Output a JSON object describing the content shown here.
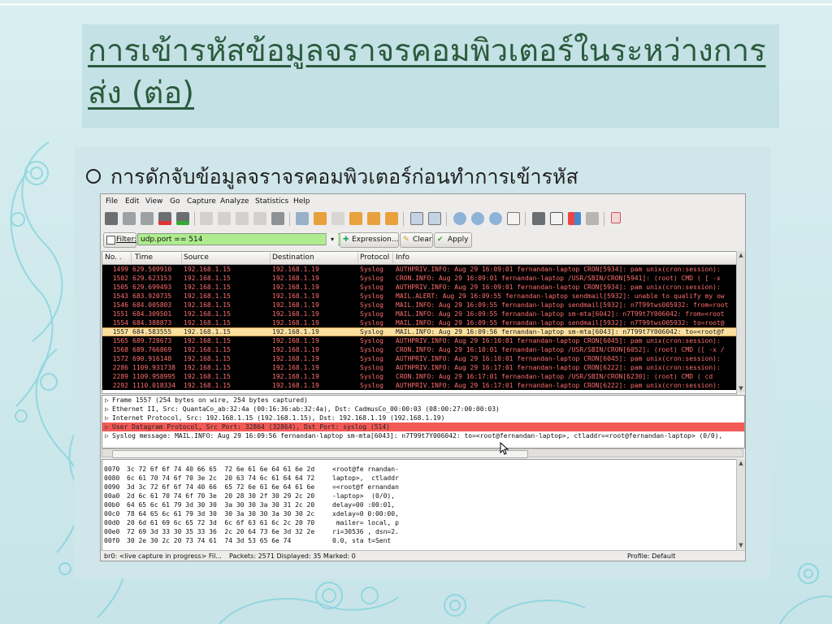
{
  "slide": {
    "title": "การเข้ารหัสข้อมูลจราจรคอมพิวเตอร์ในระหว่างการส่ง (ต่อ)",
    "bullet": "การดักจับข้อมูลจราจรคอมพิวเตอร์ก่อนทำการเข้ารหัส"
  },
  "wireshark": {
    "menu": [
      "File",
      "Edit",
      "View",
      "Go",
      "Capture",
      "Analyze",
      "Statistics",
      "Help"
    ],
    "toolbar_icons": [
      "interface-list-icon",
      "capture-options-icon",
      "start-capture-icon",
      "stop-capture-icon",
      "restart-capture-icon",
      "open-file-icon",
      "save-file-icon",
      "close-file-icon",
      "reload-icon",
      "print-icon",
      "find-packet-icon",
      "go-back-icon",
      "go-forward-icon",
      "go-to-packet-icon",
      "go-first-icon",
      "go-last-icon",
      "colorize-icon",
      "auto-scroll-icon",
      "zoom-in-icon",
      "zoom-out-icon",
      "normal-size-icon",
      "resize-columns-icon",
      "capture-filters-icon",
      "display-filters-icon",
      "coloring-rules-icon",
      "preferences-icon",
      "help-icon"
    ],
    "filter": {
      "label": "Filter:",
      "value": "udp.port == 514",
      "expression_button": "Expression...",
      "clear_button": "Clear",
      "apply_button": "Apply"
    },
    "columns": [
      "No. .",
      "Time",
      "Source",
      "Destination",
      "Protocol",
      "Info"
    ],
    "packets": [
      {
        "no": "1499",
        "time": "629.509910",
        "src": "192.168.1.15",
        "dst": "192.168.1.19",
        "proto": "Syslog",
        "info": "AUTHPRIV.INFO: Aug 29 16:09:01 fernandan-laptop CRON[5934]: pam unix(cron:session):"
      },
      {
        "no": "1502",
        "time": "629.623153",
        "src": "192.168.1.15",
        "dst": "192.168.1.19",
        "proto": "Syslog",
        "info": "CRON.INFO: Aug 29 16:09:01 fernandan-laptop /USR/SBIN/CRON[5941]: (root) CMD (  [ -x"
      },
      {
        "no": "1505",
        "time": "629.699493",
        "src": "192.168.1.15",
        "dst": "192.168.1.19",
        "proto": "Syslog",
        "info": "AUTHPRIV.INFO: Aug 29 16:09:01 fernandan-laptop CRON[5934]: pam unix(cron:session):"
      },
      {
        "no": "1543",
        "time": "683.920735",
        "src": "192.168.1.15",
        "dst": "192.168.1.19",
        "proto": "Syslog",
        "info": "MAIL.ALERT: Aug 29 16:09:55 fernandan-laptop sendmail[5932]: unable to qualify my ow"
      },
      {
        "no": "1546",
        "time": "684.005803",
        "src": "192.168.1.15",
        "dst": "192.168.1.19",
        "proto": "Syslog",
        "info": "MAIL.INFO: Aug 29 16:09:55 fernandan-laptop sendmail[5932]: n7T99tws005932: from=root"
      },
      {
        "no": "1551",
        "time": "684.309501",
        "src": "192.168.1.15",
        "dst": "192.168.1.19",
        "proto": "Syslog",
        "info": "MAIL.INFO: Aug 29 16:09:55 fernandan-laptop sm-mta[6042]: n7T99t7Y006042: from=<root"
      },
      {
        "no": "1554",
        "time": "684.388873",
        "src": "192.168.1.15",
        "dst": "192.168.1.19",
        "proto": "Syslog",
        "info": "MAIL.INFO: Aug 29 16:09:55 fernandan-laptop sendmail[5932]: n7T99tws005932: to=root@"
      },
      {
        "no": "1557",
        "time": "684.583555",
        "src": "192.168.1.15",
        "dst": "192.168.1.19",
        "proto": "Syslog",
        "info": "MAIL.INFO: Aug 29 16:09:56 fernandan-laptop sm-mta[6043]: n7T99t7Y006042: to=<root@f",
        "selected": true
      },
      {
        "no": "1565",
        "time": "689.728673",
        "src": "192.168.1.15",
        "dst": "192.168.1.19",
        "proto": "Syslog",
        "info": "AUTHPRIV.INFO: Aug 29 16:10:01 fernandan-laptop CRON[6045]: pam unix(cron:session):"
      },
      {
        "no": "1568",
        "time": "689.766869",
        "src": "192.168.1.15",
        "dst": "192.168.1.19",
        "proto": "Syslog",
        "info": "CRON.INFO: Aug 29 16:10:01 fernandan-laptop /USR/SBIN/CRON[6052]: (root) CMD ([ -x /"
      },
      {
        "no": "1572",
        "time": "690.916148",
        "src": "192.168.1.15",
        "dst": "192.168.1.19",
        "proto": "Syslog",
        "info": "AUTHPRIV.INFO: Aug 29 16:10:01 fernandan-laptop CRON[6045]: pam unix(cron:session):"
      },
      {
        "no": "2286",
        "time": "1109.931738",
        "src": "192.168.1.15",
        "dst": "192.168.1.19",
        "proto": "Syslog",
        "info": "AUTHPRIV.INFO: Aug 29 16:17:01 fernandan-laptop CRON[6222]: pam unix(cron:session):"
      },
      {
        "no": "2289",
        "time": "1109.958995",
        "src": "192.168.1.15",
        "dst": "192.168.1.19",
        "proto": "Syslog",
        "info": "CRON.INFO: Aug 29 16:17:01 fernandan-laptop /USR/SBIN/CRON[6230]: (root) CMD (   cd"
      },
      {
        "no": "2292",
        "time": "1110.018334",
        "src": "192.168.1.15",
        "dst": "192.168.1.19",
        "proto": "Syslog",
        "info": "AUTHPRIV.INFO: Aug 29 16:17:01 fernandan-laptop CRON[6222]: pam unix(cron:session):"
      }
    ],
    "details": [
      {
        "text": "Frame 1557 (254 bytes on wire, 254 bytes captured)"
      },
      {
        "text": "Ethernet II, Src: QuantaCo_ab:32:4a (00:16:36:ab:32:4a), Dst: CadmusCo_00:00:03 (08:00:27:00:00:03)"
      },
      {
        "text": "Internet Protocol, Src: 192.168.1.15 (192.168.1.15), Dst: 192.168.1.19 (192.168.1.19)"
      },
      {
        "text": "User Datagram Protocol, Src Port: 32864 (32864), Dst Port: syslog (514)",
        "highlight": true
      },
      {
        "text": "Syslog message: MAIL.INFO: Aug 29 16:09:56 fernandan-laptop sm-mta[6043]: n7T99t7Y006042: to=<root@fernandan-laptop>, ctladdr=<root@fernandan-laptop> (0/0),"
      }
    ],
    "hex": [
      {
        "off": "0070",
        "bytes": "3c 72 6f 6f 74 40 66 65  72 6e 61 6e 64 61 6e 2d",
        "ascii": "<root@fe rnandan-"
      },
      {
        "off": "0080",
        "bytes": "6c 61 70 74 6f 70 3e 2c  20 63 74 6c 61 64 64 72",
        "ascii": "laptop>,  ctladdr"
      },
      {
        "off": "0090",
        "bytes": "3d 3c 72 6f 6f 74 40 66  65 72 6e 61 6e 64 61 6e",
        "ascii": "=<root@f ernandan"
      },
      {
        "off": "00a0",
        "bytes": "2d 6c 61 70 74 6f 70 3e  20 28 30 2f 30 29 2c 20",
        "ascii": "-laptop>  (0/0),"
      },
      {
        "off": "00b0",
        "bytes": "64 65 6c 61 79 3d 30 30  3a 30 30 3a 30 31 2c 20",
        "ascii": "delay=00 :00:01,"
      },
      {
        "off": "00c0",
        "bytes": "78 64 65 6c 61 79 3d 30  30 3a 30 30 3a 30 30 2c",
        "ascii": "xdelay=0 0:00:00,"
      },
      {
        "off": "00d0",
        "bytes": "20 6d 61 69 6c 65 72 3d  6c 6f 63 61 6c 2c 20 70",
        "ascii": " mailer= local, p"
      },
      {
        "off": "00e0",
        "bytes": "72 69 3d 33 30 35 33 36  2c 20 64 73 6e 3d 32 2e",
        "ascii": "ri=30536 , dsn=2."
      },
      {
        "off": "00f0",
        "bytes": "30 2e 30 2c 20 73 74 61  74 3d 53 65 6e 74",
        "ascii": "0.0, sta t=Sent"
      }
    ],
    "status": {
      "capture": "br0: <live capture in progress> Fil...",
      "packets": "Packets: 2571 Displayed: 35 Marked: 0",
      "profile": "Profile: Default"
    },
    "colors": {
      "row_bg": "#000000",
      "row_fg": "#ff6e6e",
      "selected_bg": "#fbe0a0",
      "highlight_bg": "#f25a56",
      "filter_valid_bg": "#afec8f",
      "title_color": "#2a5b3d"
    }
  }
}
